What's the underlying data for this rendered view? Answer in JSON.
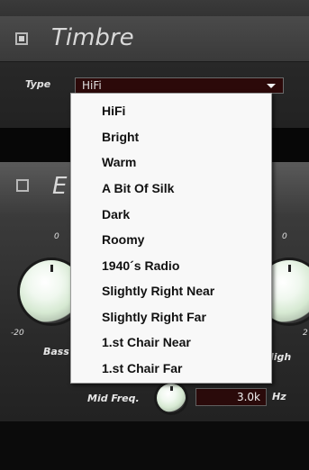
{
  "timbre": {
    "title": "Timbre",
    "enabled": true,
    "type_label": "Type",
    "type_value": "HiFi"
  },
  "eq": {
    "title_fragment": "E",
    "enabled": false,
    "bass_min": "-20",
    "bass_top": "0",
    "high_top": "0",
    "high_min": "2",
    "bass_label": "Bass",
    "high_label": "ligh",
    "mid_freq_label": "Mid Freq.",
    "mid_freq_value": "3.0k",
    "mid_freq_unit": "Hz"
  },
  "dropdown": {
    "items": [
      "HiFi",
      "Bright",
      "Warm",
      "A Bit Of Silk",
      "Dark",
      "Roomy",
      "1940´s Radio",
      "Slightly Right Near",
      "Slightly Right Far",
      "1.st Chair Near",
      "1.st Chair Far"
    ]
  }
}
